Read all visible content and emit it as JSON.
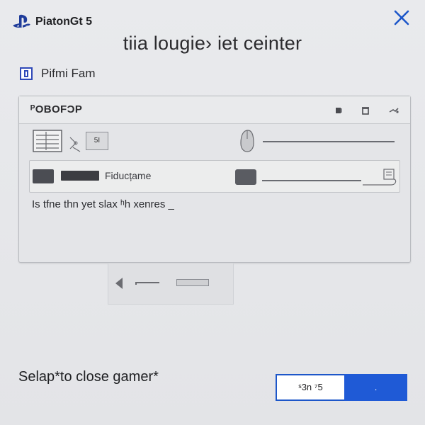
{
  "brand": {
    "title": "PiatonGt 5",
    "logo_icon": "playstation-logo-icon"
  },
  "header": {
    "title": "tiia lougie› iet ceinter",
    "close_icon": "close-icon"
  },
  "section": {
    "label": "Pifmi Fam",
    "icon": "document-icon"
  },
  "panel": {
    "title": "ᴾOBOFƆP",
    "header_icons": [
      "square-icon",
      "trash-icon",
      "link-icon"
    ],
    "row1": {
      "small_button_label": "5Ⅰ"
    },
    "row2": {
      "product_label": "Fiducțame"
    },
    "status_text": "Is tfne thn yet slax ʰh xenres _"
  },
  "pager": {
    "prev_icon": "prev-arrow-icon"
  },
  "footer": {
    "hint": "Selap*to close gamer*",
    "secondary_label": "ˢ3n ⁷5",
    "primary_label": "."
  },
  "colors": {
    "accent": "#1f5ad6",
    "close": "#1c56c9",
    "background": "#e6e7ea"
  }
}
